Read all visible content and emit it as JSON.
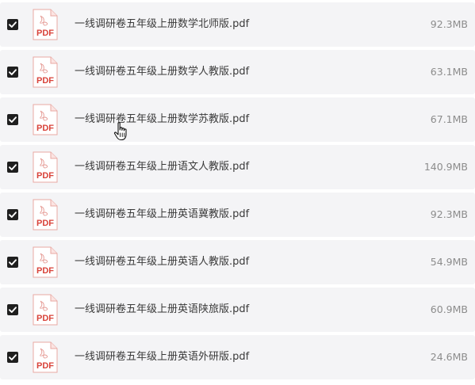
{
  "files": [
    {
      "name": "一线调研卷五年级上册数学北师版.pdf",
      "size": "92.3MB",
      "checked": true,
      "icon": "pdf-file-icon"
    },
    {
      "name": "一线调研卷五年级上册数学人教版.pdf",
      "size": "63.1MB",
      "checked": true,
      "icon": "pdf-file-icon"
    },
    {
      "name": "一线调研卷五年级上册数学苏教版.pdf",
      "size": "67.1MB",
      "checked": true,
      "icon": "pdf-file-icon"
    },
    {
      "name": "一线调研卷五年级上册语文人教版.pdf",
      "size": "140.9MB",
      "checked": true,
      "icon": "pdf-file-icon"
    },
    {
      "name": "一线调研卷五年级上册英语冀教版.pdf",
      "size": "92.3MB",
      "checked": true,
      "icon": "pdf-file-icon"
    },
    {
      "name": "一线调研卷五年级上册英语人教版.pdf",
      "size": "54.9MB",
      "checked": true,
      "icon": "pdf-file-icon"
    },
    {
      "name": "一线调研卷五年级上册英语陕旅版.pdf",
      "size": "60.9MB",
      "checked": true,
      "icon": "pdf-file-icon"
    },
    {
      "name": "一线调研卷五年级上册英语外研版.pdf",
      "size": "24.6MB",
      "checked": true,
      "icon": "pdf-file-icon"
    }
  ],
  "pdf_icon": {
    "label": "PDF",
    "color": "#d9433a"
  },
  "colors": {
    "row_background": "#f4f4f6",
    "checkbox": "#1f1f1f",
    "name_text": "#3a3a3a",
    "size_text": "#8c8c8c"
  },
  "cursor": {
    "icon": "hand-pointer-cursor"
  }
}
